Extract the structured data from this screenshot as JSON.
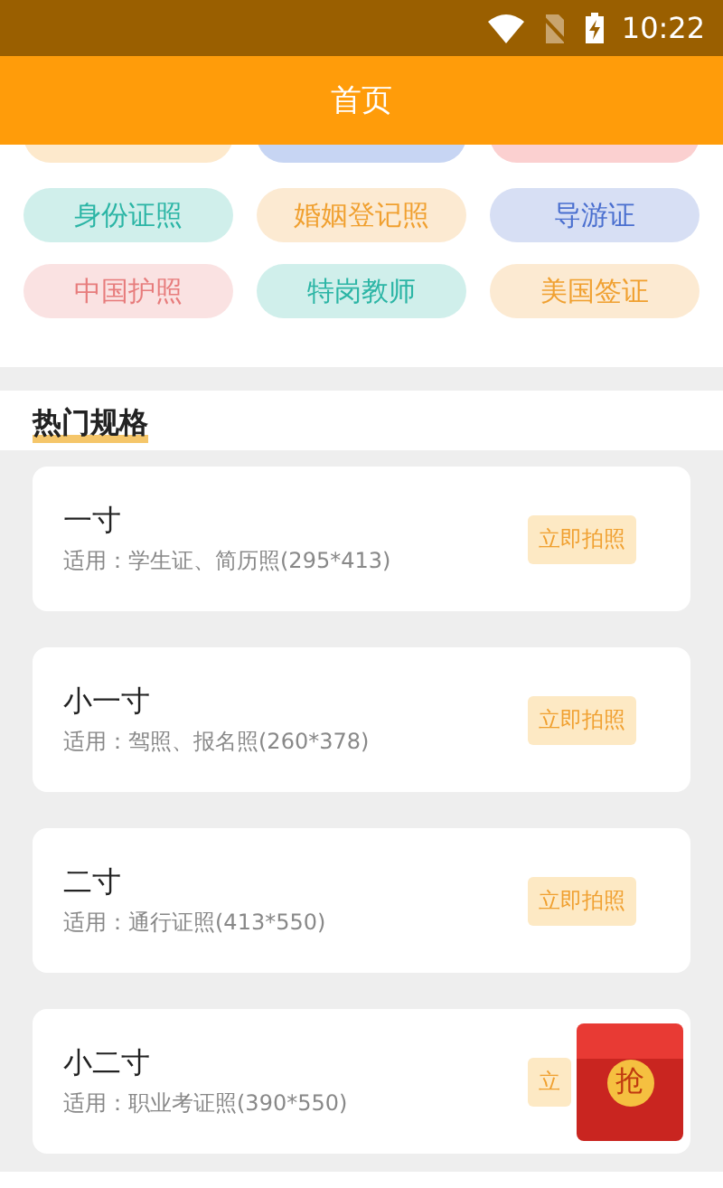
{
  "status_bar": {
    "time": "10:22"
  },
  "header": {
    "title": "首页"
  },
  "cut_pills": [
    {
      "color": "#fde9cc"
    },
    {
      "color": "#c7d5f3"
    },
    {
      "color": "#fbd0d0"
    }
  ],
  "pills": [
    {
      "label": "身份证照",
      "color": "#2bb5a5"
    },
    {
      "label": "婚姻登记照",
      "color": "#f0a030"
    },
    {
      "label": "导游证",
      "color": "#4a6fcf"
    },
    {
      "label": "中国护照",
      "color": "#e77c7c"
    },
    {
      "label": "特岗教师",
      "color": "#2bb5a5"
    },
    {
      "label": "美国签证",
      "color": "#f0a030"
    }
  ],
  "section_title": "热门规格",
  "specs": [
    {
      "title": "一寸",
      "subtitle": "适用：学生证、简历照(295*413)",
      "button": "立即拍照"
    },
    {
      "title": "小一寸",
      "subtitle": "适用：驾照、报名照(260*378)",
      "button": "立即拍照"
    },
    {
      "title": "二寸",
      "subtitle": "适用：通行证照(413*550)",
      "button": "立即拍照"
    },
    {
      "title": "小二寸",
      "subtitle": "适用：职业考证照(390*550)",
      "button": "立"
    }
  ],
  "floating_badge": {
    "label": "抢"
  }
}
